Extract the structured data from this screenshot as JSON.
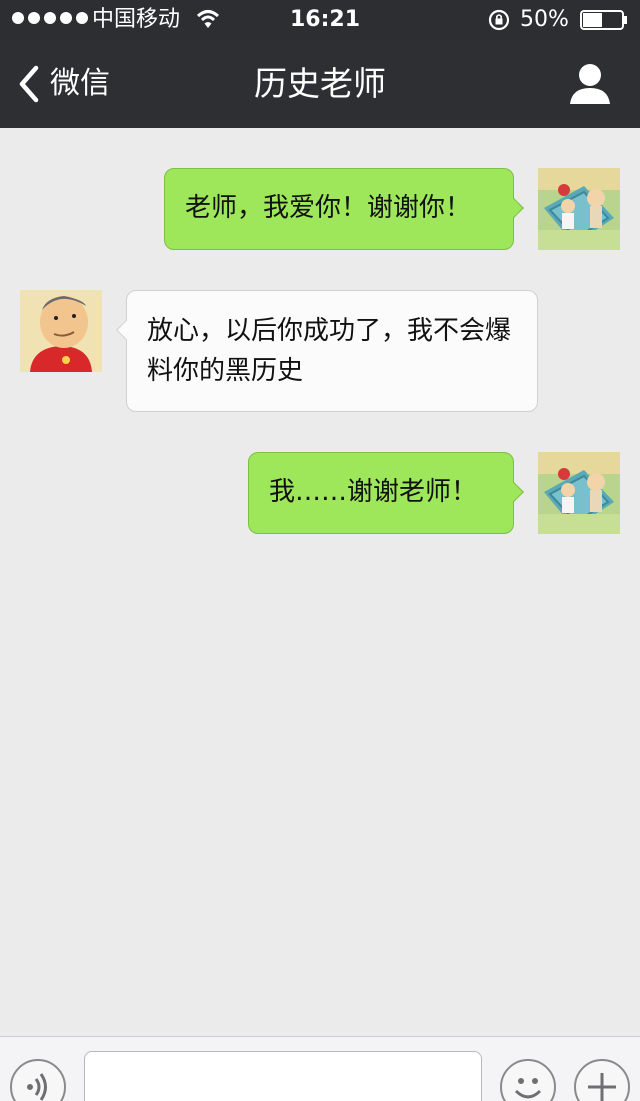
{
  "status_bar": {
    "carrier": "中国移动",
    "time": "16:21",
    "battery_percent_text": "50%",
    "battery_level": 0.5,
    "signal_bars": 5
  },
  "nav": {
    "back_label": "微信",
    "title": "历史老师"
  },
  "messages": [
    {
      "direction": "out",
      "text": "老师，我爱你！谢谢你！"
    },
    {
      "direction": "in",
      "text": "放心，以后你成功了，我不会爆料你的黑历史"
    },
    {
      "direction": "out",
      "text": "我……谢谢老师！"
    }
  ],
  "input": {
    "value": "",
    "placeholder": ""
  },
  "icons": {
    "back": "chevron-left-icon",
    "profile": "person-icon",
    "voice": "voice-icon",
    "emoji": "emoji-icon",
    "more": "plus-icon",
    "wifi": "wifi-icon",
    "rotation_lock": "rotation-lock-icon",
    "battery": "battery-icon"
  },
  "colors": {
    "nav_bg": "#2e2f33",
    "chat_bg": "#ebebeb",
    "outgoing_bubble": "#9ee65a",
    "incoming_bubble": "#fbfbfb"
  }
}
